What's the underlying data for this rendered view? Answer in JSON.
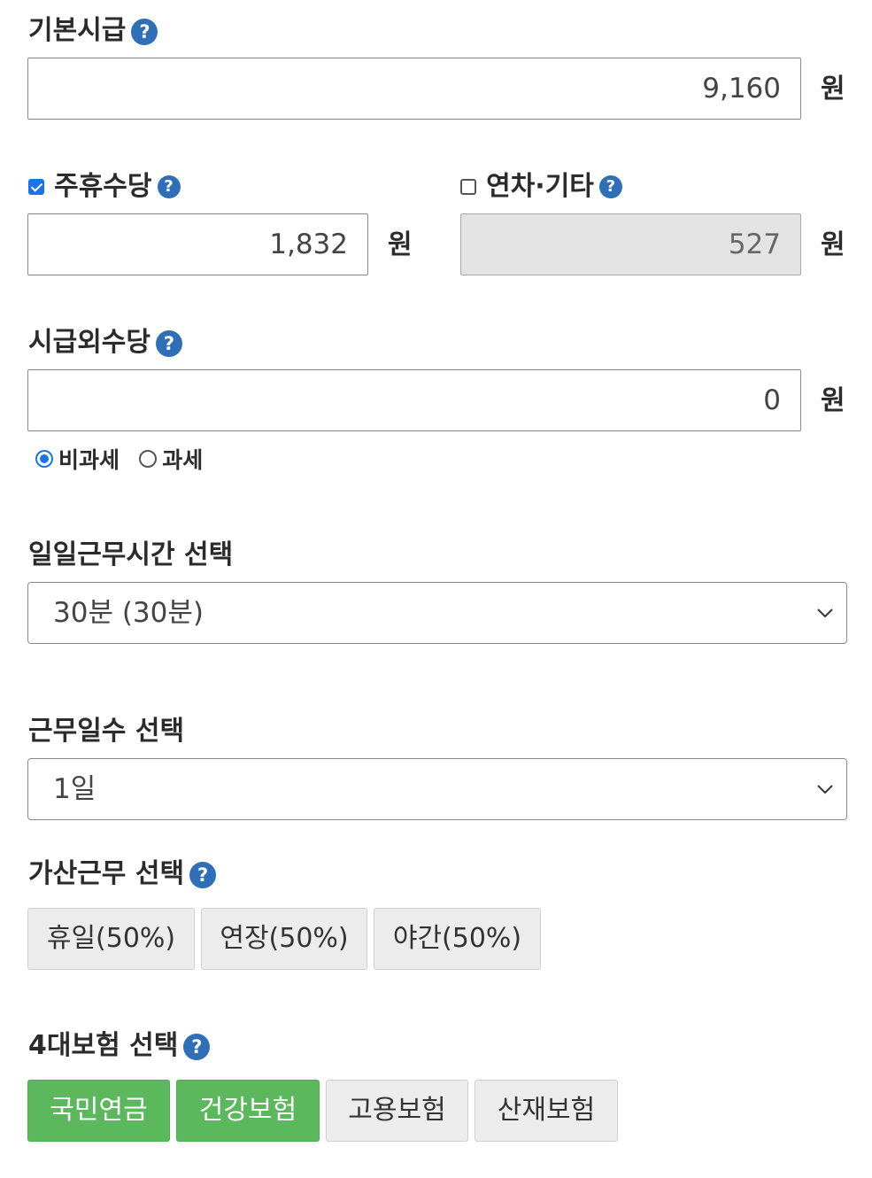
{
  "base_wage": {
    "label": "기본시급",
    "value": "9,160",
    "unit": "원"
  },
  "weekly_holiday": {
    "label": "주휴수당",
    "checked": true,
    "value": "1,832",
    "unit": "원"
  },
  "annual_other": {
    "label": "연차·기타",
    "checked": false,
    "value": "527",
    "unit": "원"
  },
  "extra_allowance": {
    "label": "시급외수당",
    "value": "0",
    "unit": "원",
    "tax_options": [
      {
        "label": "비과세",
        "selected": true
      },
      {
        "label": "과세",
        "selected": false
      }
    ]
  },
  "daily_hours": {
    "label": "일일근무시간 선택",
    "selected": "30분 (30분)"
  },
  "work_days": {
    "label": "근무일수 선택",
    "selected": "1일"
  },
  "overtime": {
    "label": "가산근무 선택",
    "buttons": [
      {
        "label": "휴일(50%)",
        "active": false
      },
      {
        "label": "연장(50%)",
        "active": false
      },
      {
        "label": "야간(50%)",
        "active": false
      }
    ]
  },
  "insurance": {
    "label": "4대보험 선택",
    "buttons": [
      {
        "label": "국민연금",
        "active": true
      },
      {
        "label": "건강보험",
        "active": true
      },
      {
        "label": "고용보험",
        "active": false
      },
      {
        "label": "산재보험",
        "active": false
      }
    ]
  },
  "help_glyph": "?",
  "colors": {
    "accent": "#2f6fb7",
    "active_button": "#5cb85c",
    "disabled_input": "#e3e3e3"
  }
}
